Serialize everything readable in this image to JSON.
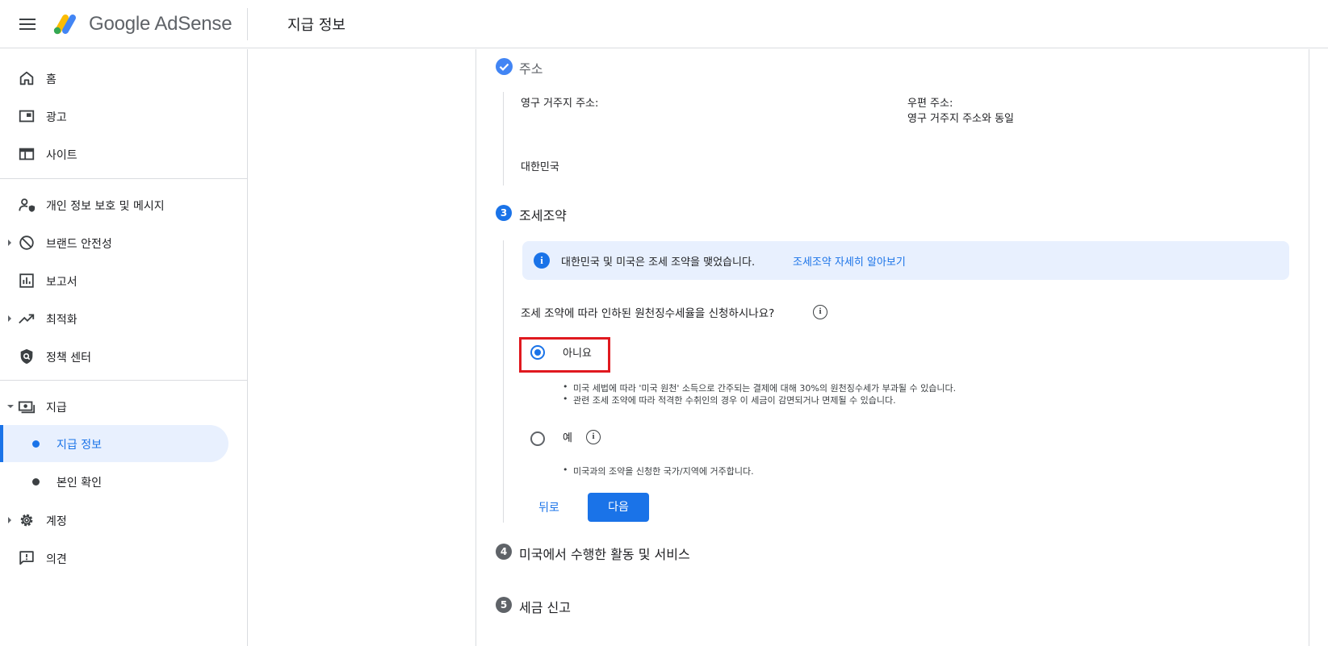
{
  "header": {
    "brand": "Google AdSense",
    "page_title": "지급 정보"
  },
  "sidebar": {
    "items": [
      {
        "label": "홈",
        "icon": "home-icon"
      },
      {
        "label": "광고",
        "icon": "ads-icon"
      },
      {
        "label": "사이트",
        "icon": "sites-icon"
      },
      {
        "label": "개인 정보 보호 및 메시지",
        "icon": "privacy-messaging-icon"
      },
      {
        "label": "브랜드 안전성",
        "icon": "block-icon"
      },
      {
        "label": "보고서",
        "icon": "reports-icon"
      },
      {
        "label": "최적화",
        "icon": "trending-icon"
      },
      {
        "label": "정책 센터",
        "icon": "policy-shield-icon"
      },
      {
        "label": "지급",
        "icon": "payments-icon"
      },
      {
        "label": "계정",
        "icon": "gear-icon"
      },
      {
        "label": "의견",
        "icon": "feedback-icon"
      }
    ],
    "payments_sub": [
      {
        "label": "지급 정보",
        "active": true
      },
      {
        "label": "본인 확인",
        "active": false
      }
    ]
  },
  "address_step": {
    "title": "주소",
    "permanent_label": "영구 거주지 주소:",
    "permanent_country": "대한민국",
    "mailing_label": "우편 주소:",
    "mailing_value": "영구 거주지 주소와 동일"
  },
  "treaty_step": {
    "number": "3",
    "title": "조세조약",
    "info_text": "대한민국 및 미국은 조세 조약을 맺었습니다.",
    "info_link": "조세조약 자세히 알아보기",
    "question": "조세 조약에 따라 인하된 원천징수세율을 신청하시나요?",
    "options": [
      {
        "label": "아니요",
        "checked": true,
        "bullets": [
          "미국 세법에 따라 '미국 원천' 소득으로 간주되는 결제에 대해 30%의 원천징수세가 부과될 수 있습니다.",
          "관련 조세 조약에 따라 적격한 수취인의 경우 이 세금이 감면되거나 면제될 수 있습니다."
        ]
      },
      {
        "label": "예",
        "checked": false,
        "bullets": [
          "미국과의 조약을 신청한 국가/지역에 거주합니다."
        ]
      }
    ],
    "back_label": "뒤로",
    "next_label": "다음"
  },
  "step4": {
    "number": "4",
    "title": "미국에서 수행한 활동 및 서비스"
  },
  "step5": {
    "number": "5",
    "title": "세금 신고"
  },
  "colors": {
    "accent": "#1a73e8",
    "highlight": "#e0191f",
    "info_bg": "#e8f0fe",
    "step_done": "#4285f4",
    "step_pending": "#5f6368"
  }
}
